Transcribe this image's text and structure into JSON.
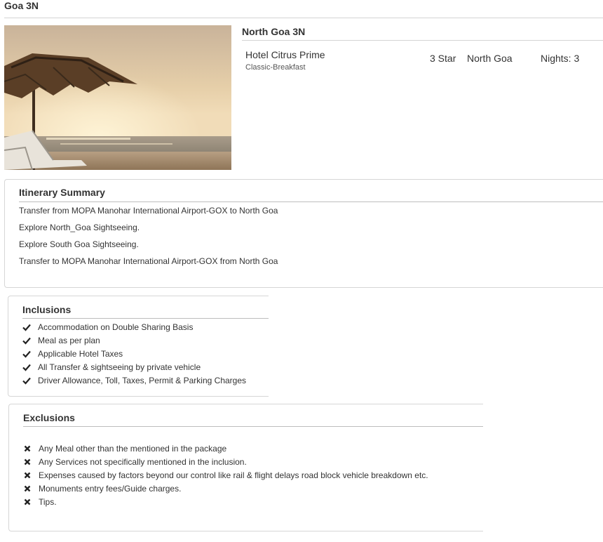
{
  "page": {
    "title": "Goa 3N"
  },
  "hotel": {
    "section_title": "North Goa 3N",
    "name": "Hotel Citrus Prime",
    "plan": "Classic-Breakfast",
    "rating": "3 Star",
    "location": "North Goa",
    "nights": "Nights: 3"
  },
  "itinerary": {
    "title": "Itinerary Summary",
    "items": [
      "Transfer from MOPA Manohar International Airport-GOX to North Goa",
      "Explore North_Goa Sightseeing.",
      "Explore South Goa Sightseeing.",
      "Transfer to MOPA Manohar International Airport-GOX from North Goa"
    ]
  },
  "inclusions": {
    "title": "Inclusions",
    "icon": "check-icon",
    "items": [
      "Accommodation on Double Sharing Basis",
      "Meal as per plan",
      "Applicable Hotel Taxes",
      "All Transfer & sightseeing by private vehicle",
      "Driver Allowance, Toll, Taxes, Permit & Parking Charges"
    ]
  },
  "exclusions": {
    "title": "Exclusions",
    "icon": "cross-icon",
    "items": [
      "Any Meal other than the mentioned in the package",
      "Any Services not specifically mentioned in the inclusion.",
      "Expenses caused by factors beyond our control like rail & flight delays road block vehicle breakdown etc.",
      "Monuments entry fees/Guide charges.",
      "Tips."
    ]
  },
  "colors": {
    "text": "#333333",
    "rule": "#d4d4d4",
    "icon": "#222222"
  }
}
